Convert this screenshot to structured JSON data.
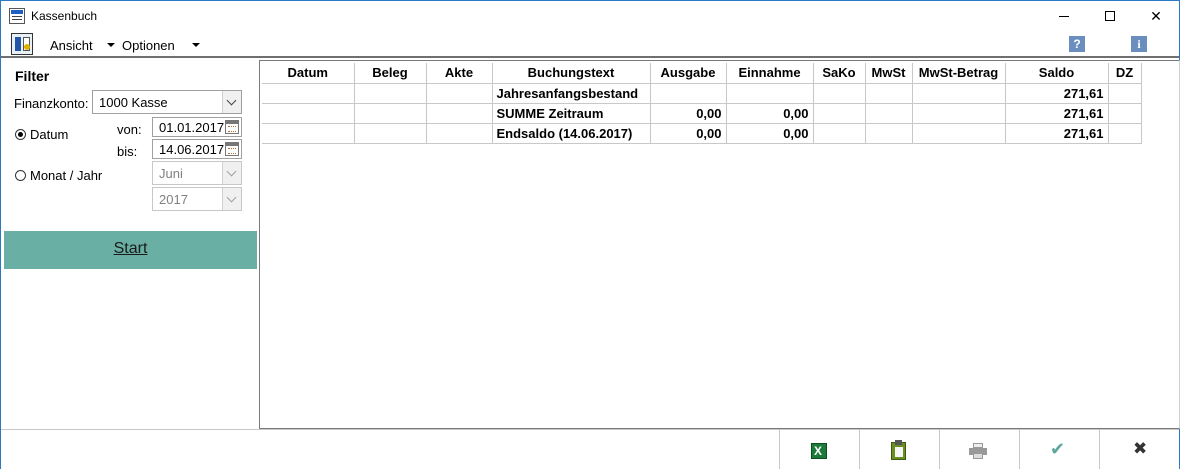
{
  "window": {
    "title": "Kassenbuch",
    "minimize_label": "",
    "close_label": "✕"
  },
  "menu": {
    "ansicht": "Ansicht",
    "optionen": "Optionen",
    "help": "?",
    "info": "i"
  },
  "filter": {
    "title": "Filter",
    "finanzkonto_label": "Finanzkonto:",
    "finanzkonto_value": "1000 Kasse",
    "datum_label": "Datum",
    "datum_selected": true,
    "von_label": "von:",
    "von_value": "01.01.2017",
    "bis_label": "bis:",
    "bis_value": "14.06.2017",
    "monat_jahr_label": "Monat / Jahr",
    "monat_value": "Juni",
    "jahr_value": "2017",
    "start_label": "Start"
  },
  "table": {
    "columns": [
      "Datum",
      "Beleg",
      "Akte",
      "Buchungstext",
      "Ausgabe",
      "Einnahme",
      "SaKo",
      "MwSt",
      "MwSt-Betrag",
      "Saldo",
      "DZ"
    ],
    "rows": [
      {
        "datum": "",
        "beleg": "",
        "akte": "",
        "buchungstext": "Jahresanfangsbestand",
        "ausgabe": "",
        "einnahme": "",
        "sako": "",
        "mwst": "",
        "mwst_betrag": "",
        "saldo": "271,61",
        "dz": ""
      },
      {
        "datum": "",
        "beleg": "",
        "akte": "",
        "buchungstext": "SUMME Zeitraum",
        "ausgabe": "0,00",
        "einnahme": "0,00",
        "sako": "",
        "mwst": "",
        "mwst_betrag": "",
        "saldo": "271,61",
        "dz": ""
      },
      {
        "datum": "",
        "beleg": "",
        "akte": "",
        "buchungstext": "Endsaldo (14.06.2017)",
        "ausgabe": "0,00",
        "einnahme": "0,00",
        "sako": "",
        "mwst": "",
        "mwst_betrag": "",
        "saldo": "271,61",
        "dz": ""
      }
    ]
  },
  "bottom": {
    "excel_icon": "excel-export-icon",
    "clipboard_icon": "clipboard-icon",
    "print_icon": "printer-icon",
    "ok_symbol": "✔",
    "close_symbol": "✖"
  },
  "colors": {
    "start_button": "#6aafa3",
    "ok_check": "#5fa79c",
    "window_border": "#2b78c5"
  }
}
